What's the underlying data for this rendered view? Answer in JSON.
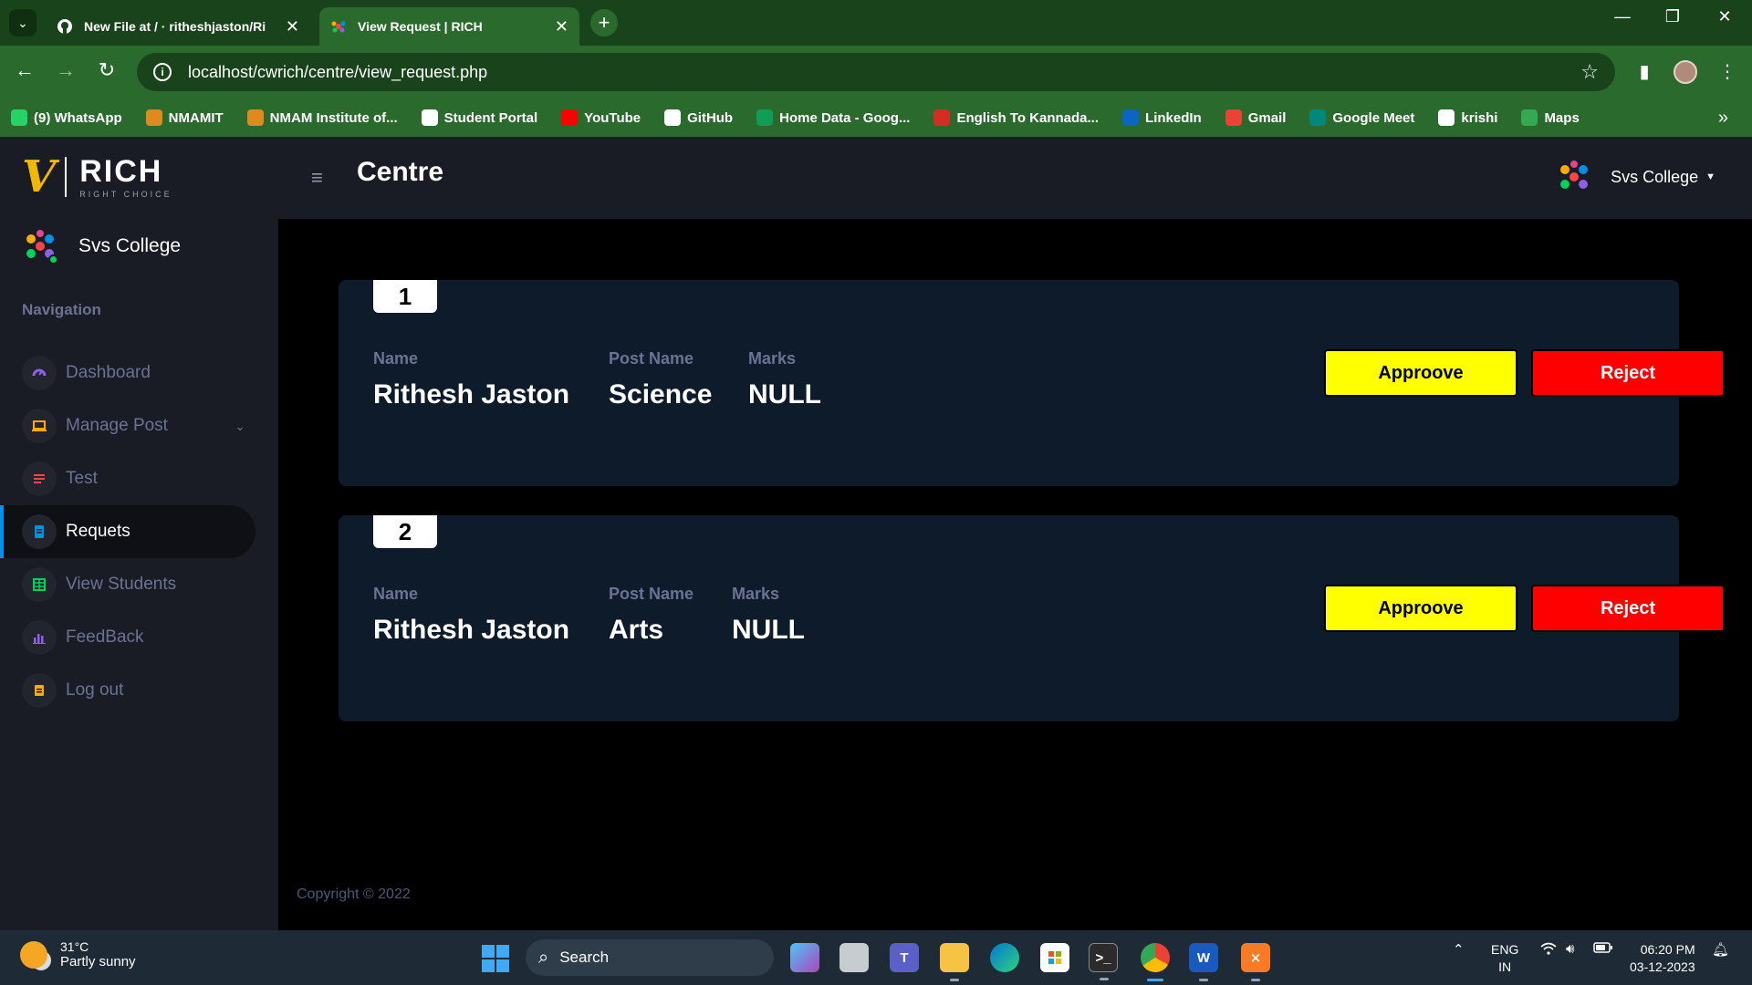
{
  "browser": {
    "tabs": [
      {
        "title": "New File at / · ritheshjaston/Ri",
        "active": false
      },
      {
        "title": "View Request | RICH",
        "active": true
      }
    ],
    "url": "localhost/cwrich/centre/view_request.php",
    "bookmarks": [
      {
        "label": "(9) WhatsApp",
        "icon": "whatsapp-icon",
        "color": "#25d366"
      },
      {
        "label": "NMAMIT",
        "icon": "nmamit-icon",
        "color": "#e08a1e"
      },
      {
        "label": "NMAM Institute of...",
        "icon": "nmamit-icon",
        "color": "#e08a1e"
      },
      {
        "label": "Student Portal",
        "icon": "globe-icon",
        "color": "#ffffff"
      },
      {
        "label": "YouTube",
        "icon": "youtube-icon",
        "color": "#ff0000"
      },
      {
        "label": "GitHub",
        "icon": "github-icon",
        "color": "#ffffff"
      },
      {
        "label": "Home Data - Goog...",
        "icon": "sheets-icon",
        "color": "#0f9d58"
      },
      {
        "label": "English To Kannada...",
        "icon": "translate-icon",
        "color": "#d62d20"
      },
      {
        "label": "LinkedIn",
        "icon": "linkedin-icon",
        "color": "#0a66c2"
      },
      {
        "label": "Gmail",
        "icon": "gmail-icon",
        "color": "#ea4335"
      },
      {
        "label": "Google Meet",
        "icon": "meet-icon",
        "color": "#00897b"
      },
      {
        "label": "krishi",
        "icon": "globe-icon",
        "color": "#ffffff"
      },
      {
        "label": "Maps",
        "icon": "maps-icon",
        "color": "#34a853"
      }
    ]
  },
  "app": {
    "logo_text": "RICH",
    "logo_tagline": "RIGHT CHOICE",
    "page_title": "Centre",
    "user_name": "Svs College",
    "nav_category": "Navigation",
    "nav_items": [
      {
        "label": "Dashboard",
        "icon": "speedometer-icon",
        "icon_color": "#8f5fe8",
        "active": false
      },
      {
        "label": "Manage Post",
        "icon": "laptop-icon",
        "icon_color": "#ffab00",
        "active": false,
        "has_chevron": true
      },
      {
        "label": "Test",
        "icon": "list-icon",
        "icon_color": "#fc424a",
        "active": false
      },
      {
        "label": "Requets",
        "icon": "document-icon",
        "icon_color": "#0090e7",
        "active": true
      },
      {
        "label": "View Students",
        "icon": "table-icon",
        "icon_color": "#00d25b",
        "active": false
      },
      {
        "label": "FeedBack",
        "icon": "chart-icon",
        "icon_color": "#8f5fe8",
        "active": false
      },
      {
        "label": "Log out",
        "icon": "logout-icon",
        "icon_color": "#ffab00",
        "active": false
      }
    ],
    "requests": [
      {
        "number": "1",
        "name_label": "Name",
        "name": "Rithesh Jaston",
        "post_label": "Post Name",
        "post": "Science",
        "marks_label": "Marks",
        "marks": "NULL",
        "approve_label": "Approove",
        "reject_label": "Reject"
      },
      {
        "number": "2",
        "name_label": "Name",
        "name": "Rithesh Jaston",
        "post_label": "Post Name",
        "post": "Arts",
        "marks_label": "Marks",
        "marks": "NULL",
        "approve_label": "Approove",
        "reject_label": "Reject"
      }
    ],
    "footer": "Copyright © 2022"
  },
  "taskbar": {
    "temperature": "31°C",
    "condition": "Partly sunny",
    "search_placeholder": "Search",
    "language": "ENG",
    "region": "IN",
    "time": "06:20 PM",
    "date": "03-12-2023"
  }
}
